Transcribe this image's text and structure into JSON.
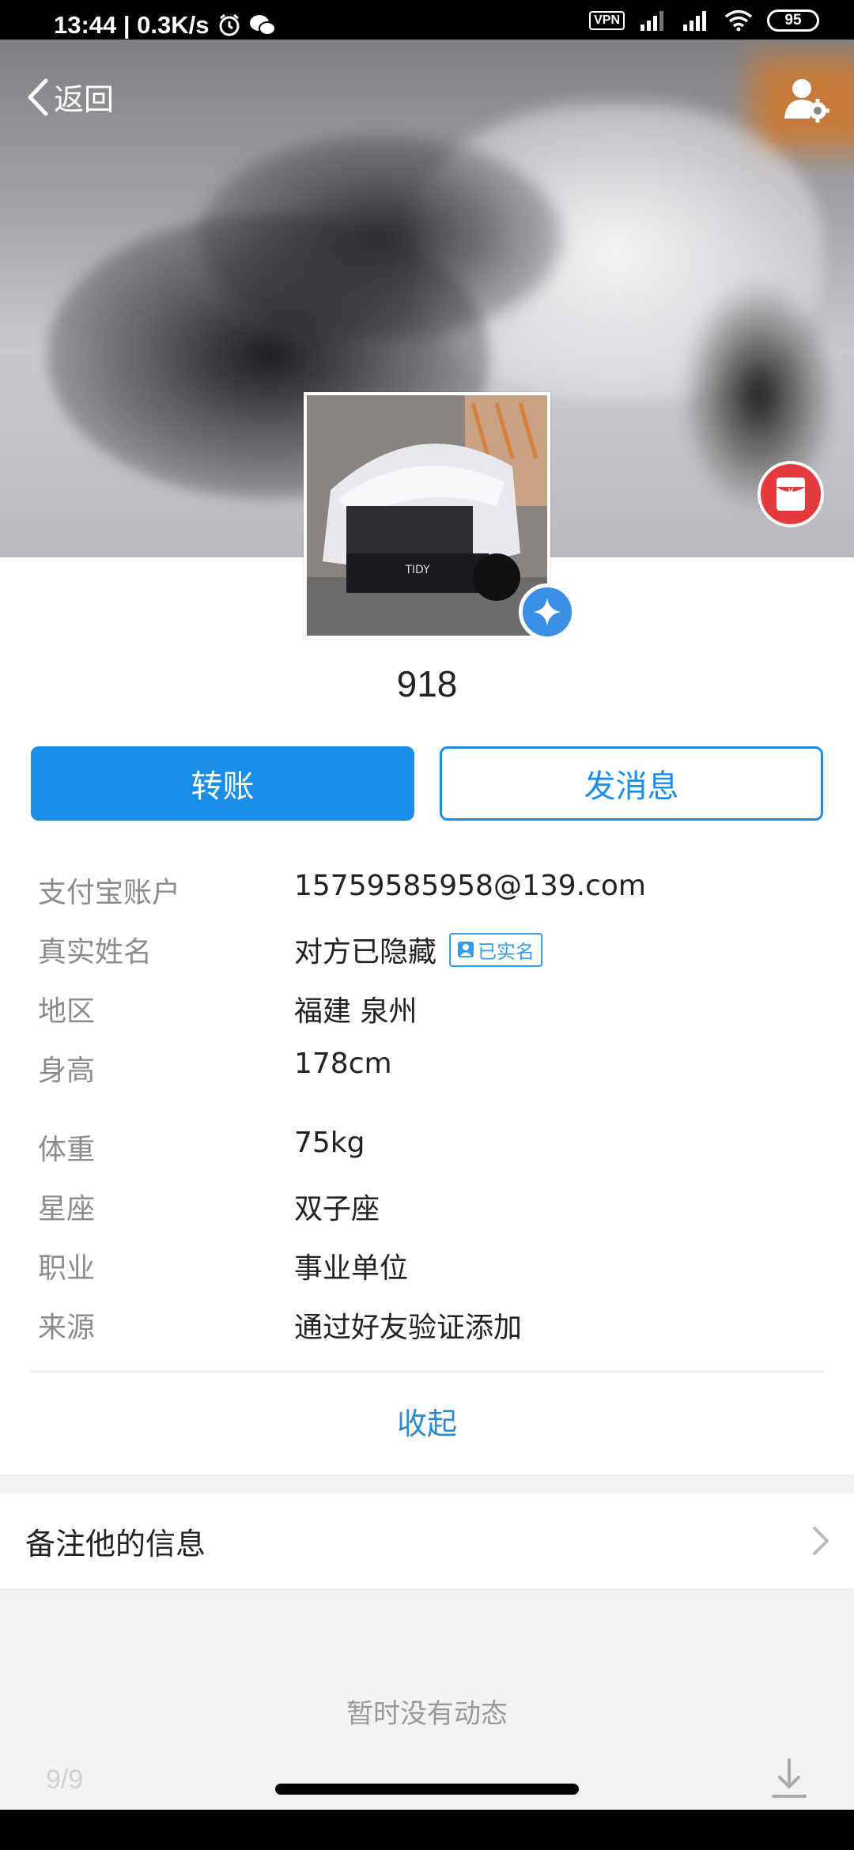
{
  "status_bar": {
    "time_speed": "13:44 | 0.3K/s",
    "vpn": "VPN",
    "battery": "95",
    "icons": [
      "alarm-icon",
      "wechat-icon",
      "signal-icon",
      "signal-icon",
      "wifi-icon",
      "battery-icon"
    ]
  },
  "header": {
    "back_label": "返回",
    "settings_icon": "user-settings-icon",
    "red_packet_icon": "red-packet-icon"
  },
  "profile": {
    "name": "918",
    "verified_icon": "verified-badge-icon"
  },
  "actions": {
    "transfer_label": "转账",
    "message_label": "发消息"
  },
  "info": [
    {
      "label": "支付宝账户",
      "value": "15759585958@139.com"
    },
    {
      "label": "真实姓名",
      "value": "对方已隐藏",
      "tag": "已实名"
    },
    {
      "label": "地区",
      "value": "福建 泉州"
    },
    {
      "label": "身高",
      "value": "178cm"
    },
    {
      "label": "体重",
      "value": "75kg"
    },
    {
      "label": "星座",
      "value": "双子座"
    },
    {
      "label": "职业",
      "value": "事业单位"
    },
    {
      "label": "来源",
      "value": "通过好友验证添加"
    }
  ],
  "collapse_label": "收起",
  "remark_label": "备注他的信息",
  "moments_empty": "暂时没有动态",
  "page_indicator": "9/9",
  "colors": {
    "primary": "#1b8fe8",
    "link": "#2f8ccf",
    "red_packet": "#e6393d",
    "muted_label": "#8c8c8c"
  }
}
